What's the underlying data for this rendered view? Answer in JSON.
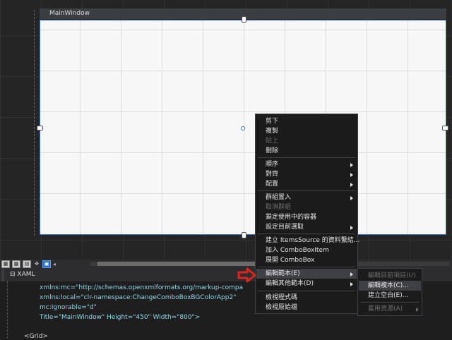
{
  "window": {
    "title": "MainWindow"
  },
  "tabs": {
    "xaml_label": "XAML"
  },
  "toolbar": {
    "zoom_icons": [
      "grid-view-icon",
      "grid-large-icon",
      "snap-icon",
      "pan-icon",
      "doc-icon"
    ]
  },
  "code": {
    "lines": [
      "xmlns:mc=\"http://schemas.openxmlformats.org/markup-compa",
      "xmlns:local=\"clr-namespace:ChangeComboBoxBGColorApp2\"",
      "mc:Ignorable=\"d\"",
      "Title=\"MainWindow\" Height=\"450\" Width=\"800\">",
      "<Grid>"
    ]
  },
  "context_menu": {
    "items": [
      {
        "label": "剪下",
        "enabled": true
      },
      {
        "label": "複製",
        "enabled": true
      },
      {
        "label": "貼上",
        "enabled": false
      },
      {
        "label": "刪除",
        "enabled": true
      },
      {
        "label": "順序",
        "enabled": true,
        "submenu": true
      },
      {
        "label": "對齊",
        "enabled": true,
        "submenu": true
      },
      {
        "label": "配置",
        "enabled": true,
        "submenu": true
      },
      {
        "label": "群組置入",
        "enabled": true,
        "submenu": true
      },
      {
        "label": "取消群組",
        "enabled": false
      },
      {
        "label": "鎖定使用中的容器",
        "enabled": true
      },
      {
        "label": "設定目前選取",
        "enabled": true,
        "submenu": true
      },
      {
        "label": "建立 ItemsSource 的資料繫結...",
        "enabled": true
      },
      {
        "label": "加入 ComboBoxItem",
        "enabled": true
      },
      {
        "label": "展開 ComboBox",
        "enabled": true
      },
      {
        "label": "編輯範本(E)",
        "enabled": true,
        "submenu": true,
        "highlighted": true
      },
      {
        "label": "編輯其他範本(D)",
        "enabled": true,
        "submenu": true
      },
      {
        "label": "檢視程式碼",
        "enabled": true
      },
      {
        "label": "檢視原始檔",
        "enabled": true
      }
    ]
  },
  "template_submenu": {
    "items": [
      {
        "label": "編輯目前項目(U)",
        "enabled": false
      },
      {
        "label": "編輯複本(C)...",
        "enabled": true,
        "highlighted": true
      },
      {
        "label": "建立空白(E)...",
        "enabled": true
      },
      {
        "label": "套用資源(A)",
        "enabled": false,
        "submenu": true
      }
    ]
  },
  "colors": {
    "highlight": "#3f3f46",
    "selection_border": "#3d6fc9",
    "annotation_arrow": "#e0241b"
  }
}
